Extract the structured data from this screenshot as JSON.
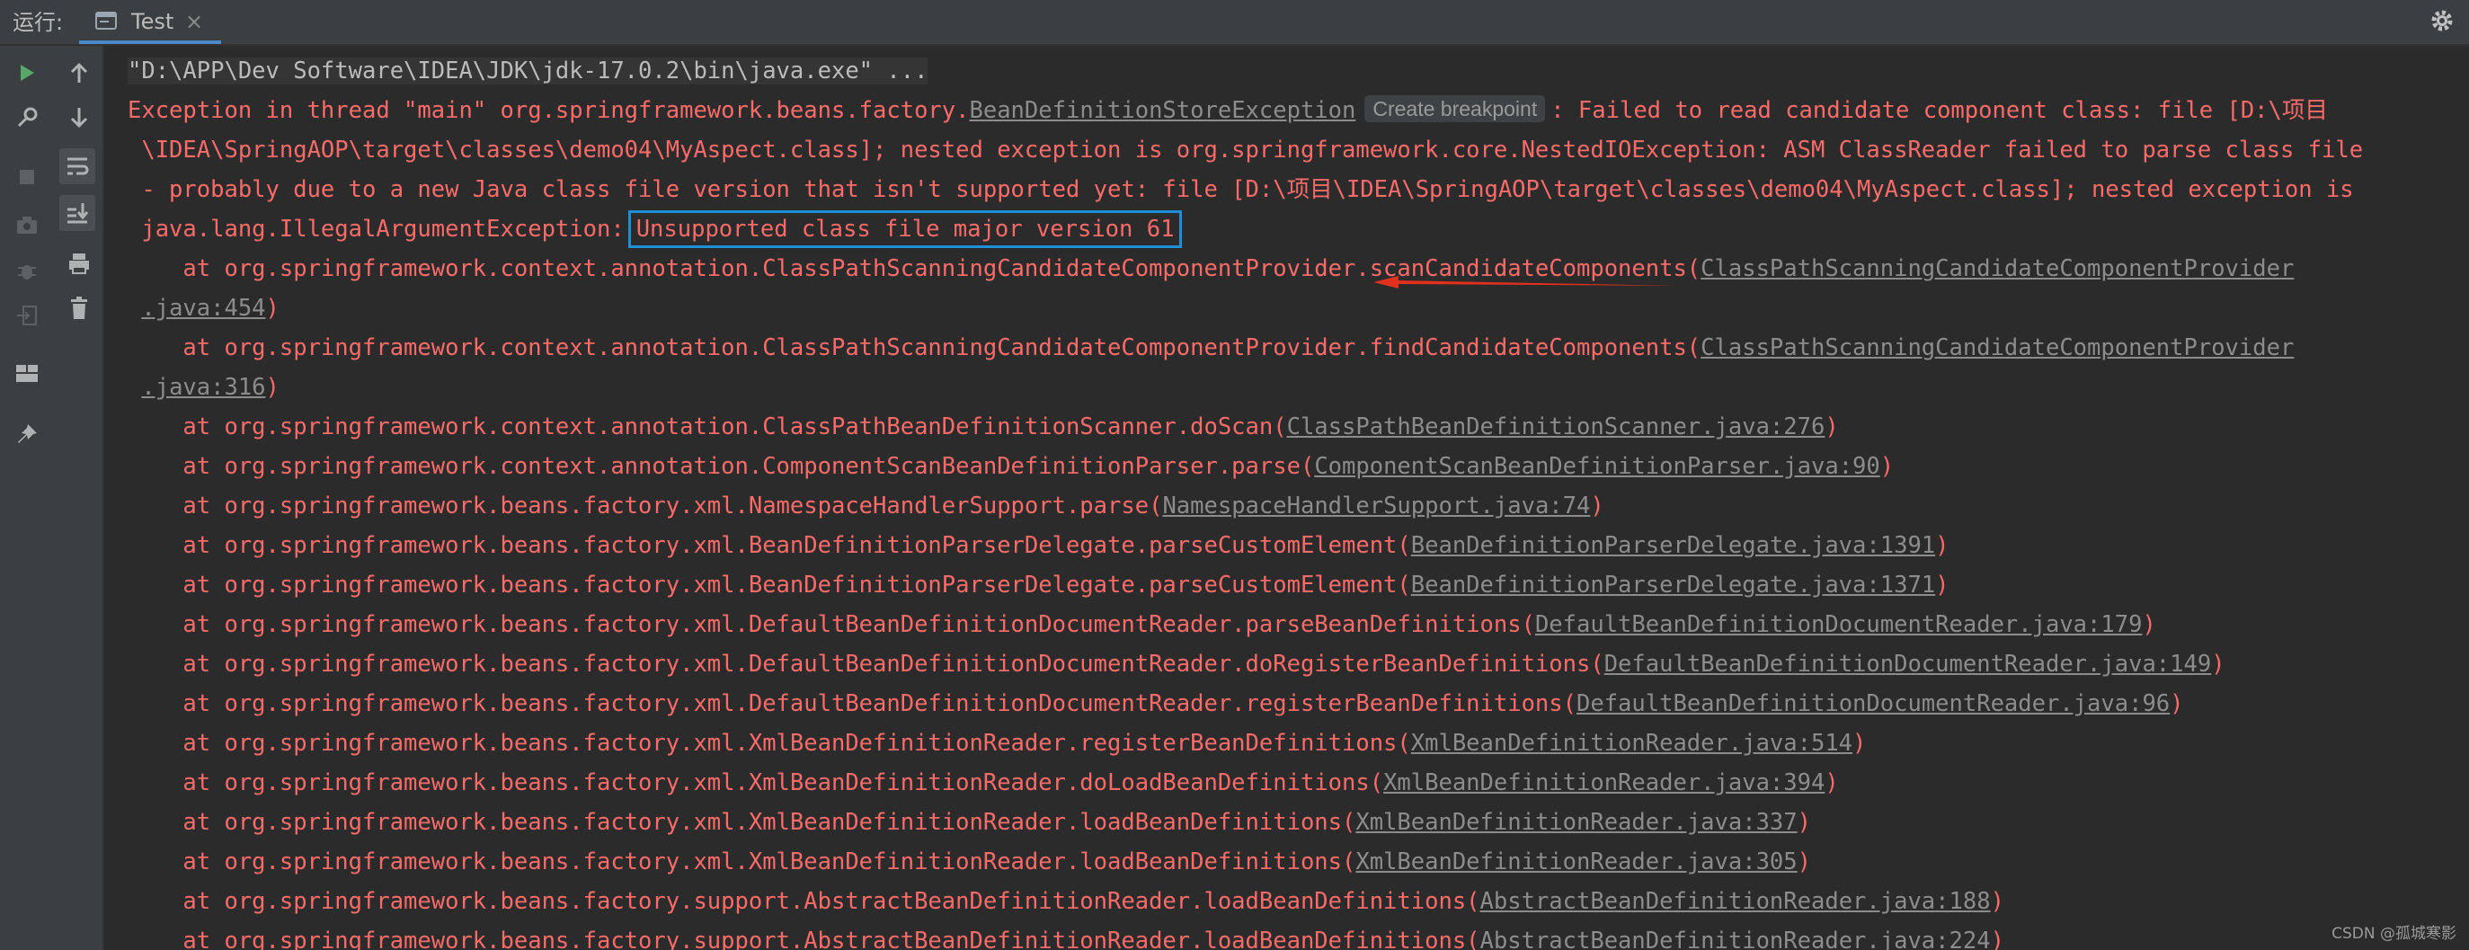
{
  "topbar": {
    "run_label": "运行:",
    "tab_label": "Test",
    "tab_close": "×",
    "settings_icon": "gear-icon"
  },
  "toolbar": {
    "buttons": [
      "rerun-icon",
      "wrench-icon",
      "stop-icon",
      "camera-icon",
      "debug-icon",
      "login-icon",
      "layout-icon",
      "pin-icon",
      "up-arrow-icon",
      "down-arrow-icon",
      "soft-wrap-icon",
      "scroll-to-end-icon",
      "print-icon",
      "trash-icon"
    ]
  },
  "console": {
    "command": "\"D:\\APP\\Dev Software\\IDEA\\JDK\\jdk-17.0.2\\bin\\java.exe\" ...",
    "exception_prefix": "Exception in thread \"main\" org.springframework.beans.factory.",
    "exception_class": "BeanDefinitionStoreException",
    "create_breakpoint": "Create breakpoint",
    "exception_suffix": ": Failed to read candidate component class: file [D:\\项目",
    "wrap1": " \\IDEA\\SpringAOP\\target\\classes\\demo04\\MyAspect.class]; nested exception is org.springframework.core.NestedIOException: ASM ClassReader failed to parse class file",
    "wrap2": " - probably due to a new Java class file version that isn't supported yet: file [D:\\项目\\IDEA\\SpringAOP\\target\\classes\\demo04\\MyAspect.class]; nested exception is",
    "wrap3_prefix": " java.lang.IllegalArgumentException:",
    "highlighted": "Unsupported class file major version 61",
    "frames": [
      {
        "text": "    at org.springframework.context.annotation.ClassPathScanningCandidateComponentProvider.scanCandidateComponents(",
        "link": "ClassPathScanningCandidateComponentProvider",
        "link2": ".java:454",
        "end": ")"
      },
      {
        "text": "    at org.springframework.context.annotation.ClassPathScanningCandidateComponentProvider.findCandidateComponents(",
        "link": "ClassPathScanningCandidateComponentProvider",
        "link2": ".java:316",
        "end": ")"
      },
      {
        "text": "    at org.springframework.context.annotation.ClassPathBeanDefinitionScanner.doScan(",
        "link": "ClassPathBeanDefinitionScanner.java:276",
        "end": ")"
      },
      {
        "text": "    at org.springframework.context.annotation.ComponentScanBeanDefinitionParser.parse(",
        "link": "ComponentScanBeanDefinitionParser.java:90",
        "end": ")"
      },
      {
        "text": "    at org.springframework.beans.factory.xml.NamespaceHandlerSupport.parse(",
        "link": "NamespaceHandlerSupport.java:74",
        "end": ")"
      },
      {
        "text": "    at org.springframework.beans.factory.xml.BeanDefinitionParserDelegate.parseCustomElement(",
        "link": "BeanDefinitionParserDelegate.java:1391",
        "end": ")"
      },
      {
        "text": "    at org.springframework.beans.factory.xml.BeanDefinitionParserDelegate.parseCustomElement(",
        "link": "BeanDefinitionParserDelegate.java:1371",
        "end": ")"
      },
      {
        "text": "    at org.springframework.beans.factory.xml.DefaultBeanDefinitionDocumentReader.parseBeanDefinitions(",
        "link": "DefaultBeanDefinitionDocumentReader.java:179",
        "end": ")"
      },
      {
        "text": "    at org.springframework.beans.factory.xml.DefaultBeanDefinitionDocumentReader.doRegisterBeanDefinitions(",
        "link": "DefaultBeanDefinitionDocumentReader.java:149",
        "end": ")"
      },
      {
        "text": "    at org.springframework.beans.factory.xml.DefaultBeanDefinitionDocumentReader.registerBeanDefinitions(",
        "link": "DefaultBeanDefinitionDocumentReader.java:96",
        "end": ")"
      },
      {
        "text": "    at org.springframework.beans.factory.xml.XmlBeanDefinitionReader.registerBeanDefinitions(",
        "link": "XmlBeanDefinitionReader.java:514",
        "end": ")"
      },
      {
        "text": "    at org.springframework.beans.factory.xml.XmlBeanDefinitionReader.doLoadBeanDefinitions(",
        "link": "XmlBeanDefinitionReader.java:394",
        "end": ")"
      },
      {
        "text": "    at org.springframework.beans.factory.xml.XmlBeanDefinitionReader.loadBeanDefinitions(",
        "link": "XmlBeanDefinitionReader.java:337",
        "end": ")"
      },
      {
        "text": "    at org.springframework.beans.factory.xml.XmlBeanDefinitionReader.loadBeanDefinitions(",
        "link": "XmlBeanDefinitionReader.java:305",
        "end": ")"
      },
      {
        "text": "    at org.springframework.beans.factory.support.AbstractBeanDefinitionReader.loadBeanDefinitions(",
        "link": "AbstractBeanDefinitionReader.java:188",
        "end": ")"
      },
      {
        "text": "    at org.springframework.beans.factory.support.AbstractBeanDefinitionReader.loadBeanDefinitions(",
        "link": "AbstractBeanDefinitionReader.java:224",
        "end": ")"
      }
    ]
  },
  "watermark": "CSDN @孤城寒影",
  "colors": {
    "error_text": "#ff6b68",
    "link_text": "#8c8c8c",
    "highlight_border": "#1e90d8",
    "arrow": "#e0301e",
    "background": "#2b2b2b"
  }
}
